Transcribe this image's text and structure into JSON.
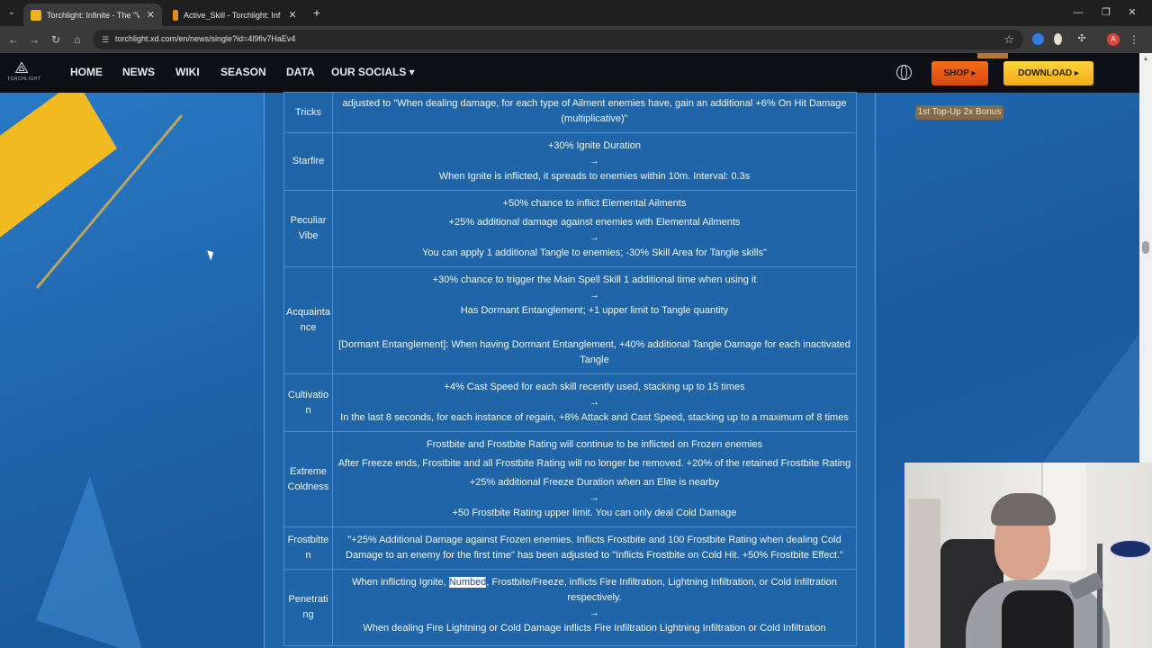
{
  "browser": {
    "tabs": [
      {
        "title": "Torchlight: Infinite - The \"Vorax\"",
        "active": true,
        "favicon_color": "#f0b21c"
      },
      {
        "title": "Active_Skill - Torchlight: Infinite",
        "active": false,
        "favicon_color": "#e58b20"
      }
    ],
    "url": "torchlight.xd.com/en/news/single?id=4l9fiv7HaEv4",
    "profile_initial": "A"
  },
  "site": {
    "logo_text": "TORCHLIGHT",
    "nav": [
      "HOME",
      "NEWS",
      "WIKI",
      "SEASON",
      "DATA",
      "OUR SOCIALS ▾"
    ],
    "shop_label": "SHOP ▸",
    "download_label": "DOWNLOAD ▸",
    "bonus_label": "1st Top-Up 2x Bonus",
    "colors": {
      "shop": "#e35a14",
      "download": "#f7c42a",
      "panel": "#2065a8"
    }
  },
  "rows": [
    {
      "name": "Tricks",
      "lines": [
        "adjusted to \"When dealing damage, for each type of Ailment enemies have, gain an additional +6% On Hit Damage (multiplicative)\""
      ]
    },
    {
      "name": "Starfire",
      "lines": [
        "+30% Ignite Duration",
        "→",
        "When Ignite is inflicted, it spreads to enemies within 10m. Interval: 0.3s"
      ]
    },
    {
      "name": "Peculiar Vibe",
      "lines": [
        "+50% chance to inflict Elemental Ailments",
        "+25% additional damage against enemies with Elemental Ailments",
        "→",
        "You can apply 1 additional Tangle to enemies; -30% Skill Area for Tangle skills\""
      ]
    },
    {
      "name": "Acquaintance",
      "lines": [
        "+30% chance to trigger the Main Spell Skill 1 additional time when using it",
        "→",
        "Has Dormant Entanglement; +1 upper limit to Tangle quantity",
        "",
        "[Dormant Entanglement]: When having Dormant Entanglement, +40% additional Tangle Damage for each inactivated Tangle"
      ]
    },
    {
      "name": "Cultivation",
      "lines": [
        "+4% Cast Speed for each skill recently used, stacking up to 15 times",
        "→",
        "In the last 8 seconds, for each instance of regain, +8% Attack and Cast Speed, stacking up to a maximum of 8 times"
      ]
    },
    {
      "name": "Extreme Coldness",
      "lines": [
        "Frostbite and Frostbite Rating will continue to be inflicted on Frozen enemies",
        "After Freeze ends, Frostbite and all Frostbite Rating will no longer be removed. +20% of the retained Frostbite Rating",
        "+25% additional Freeze Duration when an Elite is nearby",
        "→",
        "+50 Frostbite Rating upper limit. You can only deal Cold Damage"
      ]
    },
    {
      "name": "Frostbitten",
      "lines": [
        "\"+25% Additional Damage against Frozen enemies. Inflicts Frostbite and 100 Frostbite Rating when dealing Cold Damage to an enemy for the first time\" has been adjusted to \"Inflicts Frostbite on Cold Hit. +50% Frostbite Effect.\""
      ]
    },
    {
      "name": "Penetrating",
      "lines": [
        "When inflicting Ignite, Numbed, Frostbite/Freeze, inflicts Fire Infiltration, Lightning Infiltration, or Cold Infiltration respectively.",
        "→",
        "When dealing Fire Lightning or Cold Damage inflicts Fire Infiltration Lightning Infiltration or Cold Infiltration"
      ]
    }
  ],
  "highlight_word": "Numbed"
}
